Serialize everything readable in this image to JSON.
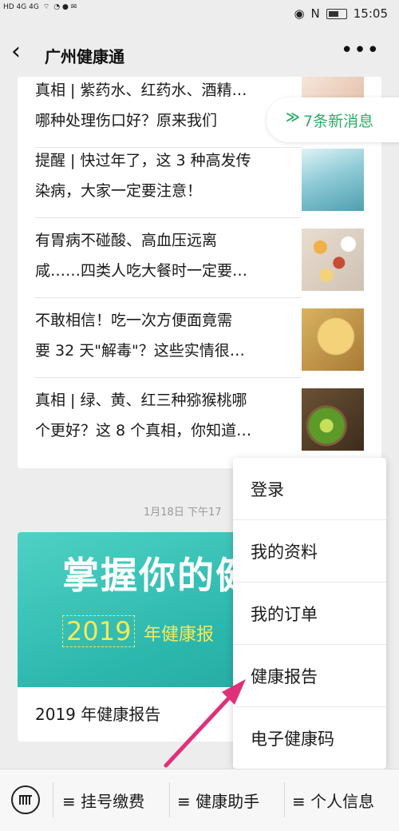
{
  "status_bar": {
    "left_text": "HD 4G 4G",
    "time": "15:05"
  },
  "header": {
    "back_icon": "‹",
    "title": "广州健康通",
    "more_icon": "•••"
  },
  "articles": [
    {
      "title": "真相 | 紫药水、红药水、酒精…\n哪种处理伤口好？原来我们"
    },
    {
      "title": "提醒 | 快过年了，这 3 种高发传\n染病，大家一定要注意！"
    },
    {
      "title": "有胃病不碰酸、高血压远离\n咸……四类人吃大餐时一定要…"
    },
    {
      "title": "不敢相信！吃一次方便面竟需\n要 32 天\"解毒\"？这些实情很…"
    },
    {
      "title": "真相 | 绿、黄、红三种猕猴桃哪\n个更好？这 8 个真相，你知道…"
    }
  ],
  "new_messages": {
    "icon": "≫",
    "label": "7条新消息"
  },
  "timestamp": "1月18日 下午17",
  "promo": {
    "headline": "掌握你的健",
    "year": "2019",
    "sub": "年健康报",
    "title": "2019 年健康报告"
  },
  "menu": {
    "items": [
      "登录",
      "我的资料",
      "我的订单",
      "健康报告",
      "电子健康码"
    ]
  },
  "bottom_bar": {
    "tabs": [
      "≡ 挂号缴费",
      "≡ 健康助手",
      "≡ 个人信息"
    ]
  },
  "colors": {
    "accent_green": "#2aae67",
    "arrow_pink": "#e0307a",
    "banner_teal": "#2bb7ad"
  }
}
